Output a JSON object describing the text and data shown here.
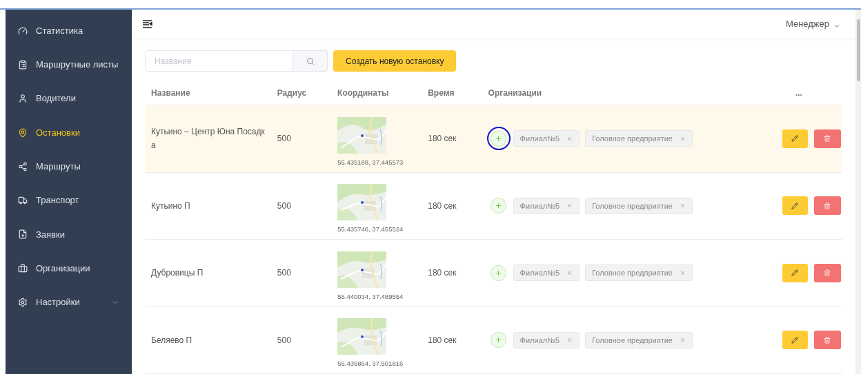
{
  "sidebar": {
    "items": [
      {
        "label": "Статистика",
        "selected": false
      },
      {
        "label": "Маршрутные листы",
        "selected": false
      },
      {
        "label": "Водители",
        "selected": false
      },
      {
        "label": "Остановки",
        "selected": true
      },
      {
        "label": "Маршруты",
        "selected": false
      },
      {
        "label": "Транспорт",
        "selected": false
      },
      {
        "label": "Заявки",
        "selected": false
      },
      {
        "label": "Организации",
        "selected": false
      },
      {
        "label": "Настройки",
        "selected": false,
        "expandable": true
      }
    ]
  },
  "header": {
    "user": "Менеджер"
  },
  "toolbar": {
    "search": {
      "placeholder": "Название"
    },
    "create_button": "Создать новую остановку"
  },
  "table": {
    "columns": [
      "Название",
      "Радиус",
      "Координаты",
      "Время",
      "Организации",
      "..."
    ],
    "rows": [
      {
        "name": "Кутьино – Центр Юна Посадка",
        "radius": "500",
        "coords": "55.435188, 37.445573",
        "time": "180 сек",
        "orgs": [
          "Филиал№5",
          "Головное предприятие"
        ],
        "selected": true,
        "circled": true
      },
      {
        "name": "Кутьино П",
        "radius": "500",
        "coords": "55.435746, 37.455524",
        "time": "180 сек",
        "orgs": [
          "Филиал№5",
          "Головное предприятие"
        ],
        "selected": false,
        "circled": false
      },
      {
        "name": "Дубровицы П",
        "radius": "500",
        "coords": "55.440034, 37.489554",
        "time": "180 сек",
        "orgs": [
          "Филиал№5",
          "Головное предприятие"
        ],
        "selected": false,
        "circled": false
      },
      {
        "name": "Беляево П",
        "radius": "500",
        "coords": "55.435864, 37.501816",
        "time": "180 сек",
        "orgs": [
          "Филиал№5",
          "Головное предприятие"
        ],
        "selected": false,
        "circled": false
      }
    ]
  }
}
